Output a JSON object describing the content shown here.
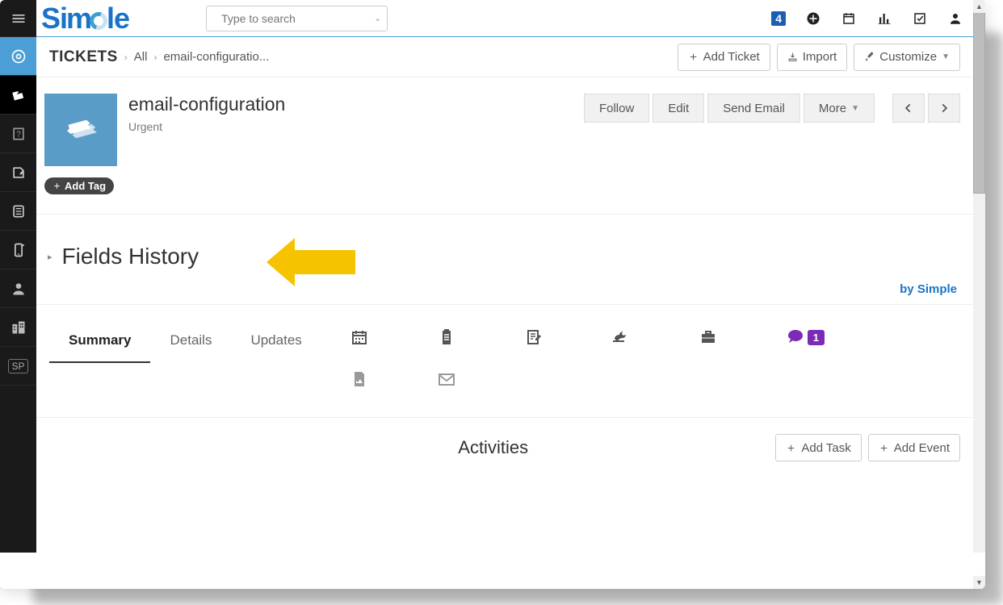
{
  "logo_text": "Simple",
  "search": {
    "placeholder": "Type to search"
  },
  "notification_badge": "4",
  "breadcrumbs": {
    "module": "TICKETS",
    "filter": "All",
    "record": "email-configuratio..."
  },
  "toolbar": {
    "add_ticket": "Add Ticket",
    "import": "Import",
    "customize": "Customize"
  },
  "record": {
    "title": "email-configuration",
    "priority": "Urgent",
    "add_tag": "Add Tag"
  },
  "actions": {
    "follow": "Follow",
    "edit": "Edit",
    "send_email": "Send Email",
    "more": "More"
  },
  "fields_history": {
    "title": "Fields History",
    "by_link": "by Simple"
  },
  "tabs": {
    "text": [
      "Summary",
      "Details",
      "Updates"
    ],
    "active_index": 0,
    "comment_badge": "1"
  },
  "activities": {
    "title": "Activities",
    "add_task": "Add Task",
    "add_event": "Add Event"
  },
  "sidebar": {
    "sp_label": "SP"
  }
}
